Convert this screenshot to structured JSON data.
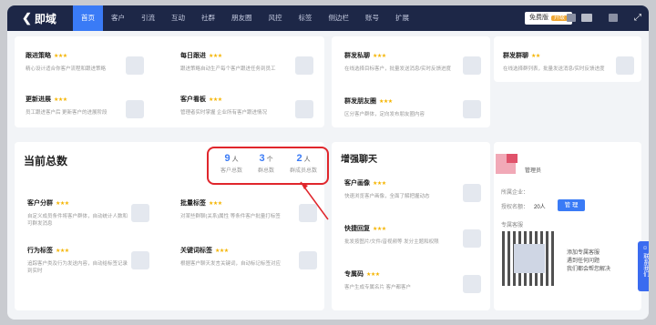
{
  "brand": {
    "name": "即域"
  },
  "nav": [
    "首页",
    "客户",
    "引流",
    "互动",
    "社群",
    "朋友圈",
    "风控",
    "标签",
    "侧边栏",
    "账号",
    "扩展"
  ],
  "top_right": {
    "badge_label": "免费版",
    "badge_tag": "升级"
  },
  "top_left_items": [
    {
      "title": "跟进策略",
      "stars": "★★★",
      "desc": "精心设计适合你客户流程和跟进策略"
    },
    {
      "title": "每日跟进",
      "stars": "★★★",
      "desc": "跟进策略自动生产每个客户跟进任务到员工"
    },
    {
      "title": "更新进展",
      "stars": "★★★",
      "desc": "员工跟进客户后 更新客户的进展阶段"
    },
    {
      "title": "客户看板",
      "stars": "★★★",
      "desc": "管理者实时掌握 企业所有客户跟进情况"
    }
  ],
  "top_right_items": [
    {
      "title": "群发私聊",
      "stars": "★★★",
      "desc": "在线选择目标客户，批量发送消息/实时反馈进度"
    },
    {
      "title": "群发群聊",
      "stars": "★★",
      "desc": "在线选择群列表，批量发送消息/实时反馈进度"
    },
    {
      "title": "群发朋友圈",
      "stars": "★★★",
      "desc": "区分客户群体，定向发布朋友圈内容"
    }
  ],
  "summary": {
    "title": "当前总数",
    "stats": [
      {
        "num": "9",
        "unit": "人",
        "label": "客户总数"
      },
      {
        "num": "3",
        "unit": "个",
        "label": "群总数"
      },
      {
        "num": "2",
        "unit": "人",
        "label": "群成员总数"
      }
    ],
    "items": [
      {
        "title": "客户分群",
        "stars": "★★★",
        "desc": "自定义成员条件将客户群体，自动统计人数和可群发消息"
      },
      {
        "title": "批量标签",
        "stars": "★★★",
        "desc": "对某些群聊(关系)属性 等条件客户批量打标签"
      },
      {
        "title": "行为标签",
        "stars": "★★★",
        "desc": "追踪客户类及行为发送内容，自动给标签记录到实时"
      },
      {
        "title": "关键词标签",
        "stars": "★★★",
        "desc": "根据客户聊天发言关键词，自动标记标签对应"
      }
    ]
  },
  "enhance": {
    "title": "增强聊天",
    "items": [
      {
        "title": "客户画像",
        "stars": "★★★",
        "desc": "快速浏览客户画像，全面了解把握动态"
      },
      {
        "title": "快捷回复",
        "stars": "★★★",
        "desc": "批发按图片/文件/音视频等 发分主题和权限"
      },
      {
        "title": "专属码",
        "stars": "★★★",
        "desc": "客户生成专属名片 客户都客户"
      }
    ]
  },
  "admin": {
    "role": "管理员",
    "company_label": "所属企业：",
    "seats_label": "授权名额：",
    "seats_value": "20人",
    "manage_label": "管 理",
    "service_label": "专属客服",
    "service_text": [
      "添加专属客服",
      "遇到任何问题",
      "我们都会帮您解决"
    ]
  },
  "side_button": "联系我们"
}
